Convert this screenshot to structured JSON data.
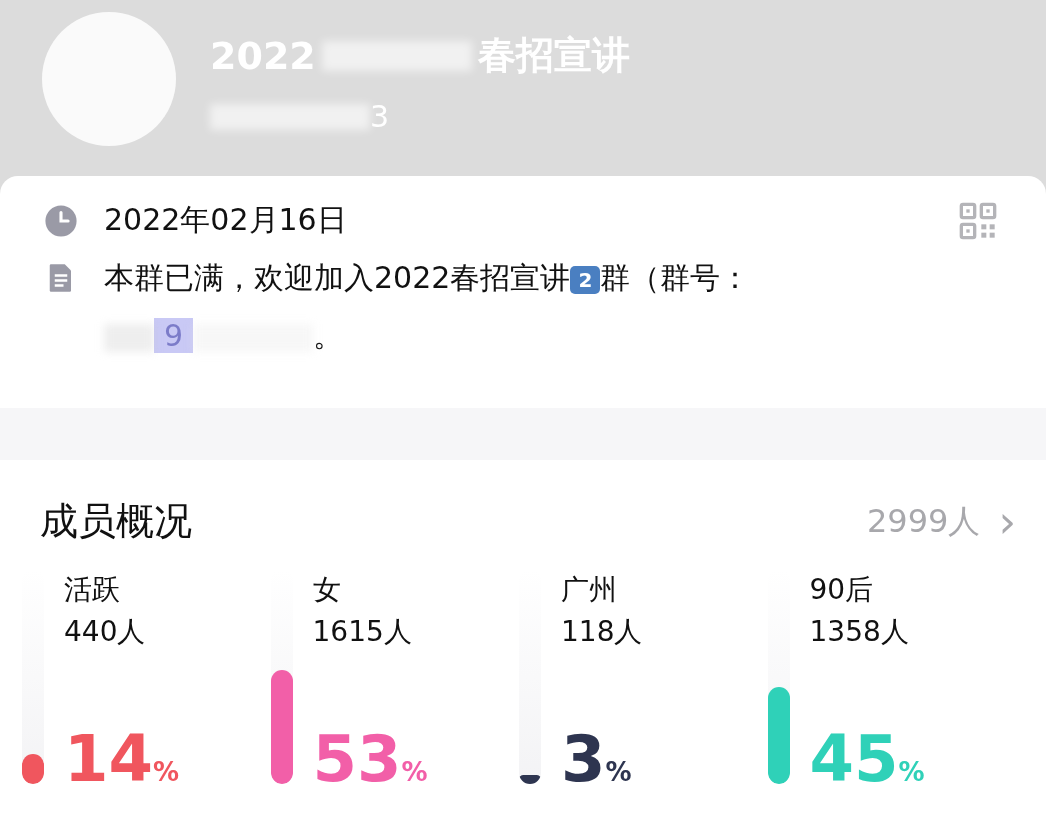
{
  "header": {
    "title_start": "2022",
    "title_end": "春招宣讲",
    "subtitle_end": "3"
  },
  "info": {
    "date": "2022年02月16日",
    "notice_parts": [
      "本群已满，欢迎加入2022春招宣讲",
      "2",
      "群（群号："
    ],
    "group_number_visible": "9",
    "notice_end": "。"
  },
  "members": {
    "title": "成员概况",
    "total": "2999人",
    "chevron": "›",
    "stats": [
      {
        "label": "活跃",
        "count": "440人",
        "percent": "14",
        "unit": "%",
        "level": 0.14,
        "color": "#f0565e"
      },
      {
        "label": "女",
        "count": "1615人",
        "percent": "53",
        "unit": "%",
        "level": 0.53,
        "color": "#f25fa8"
      },
      {
        "label": "广州",
        "count": "118人",
        "percent": "3",
        "unit": "%",
        "level": 0.03,
        "color": "#2e3550"
      },
      {
        "label": "90后",
        "count": "1358人",
        "percent": "45",
        "unit": "%",
        "level": 0.45,
        "color": "#2fd1b8"
      }
    ]
  }
}
